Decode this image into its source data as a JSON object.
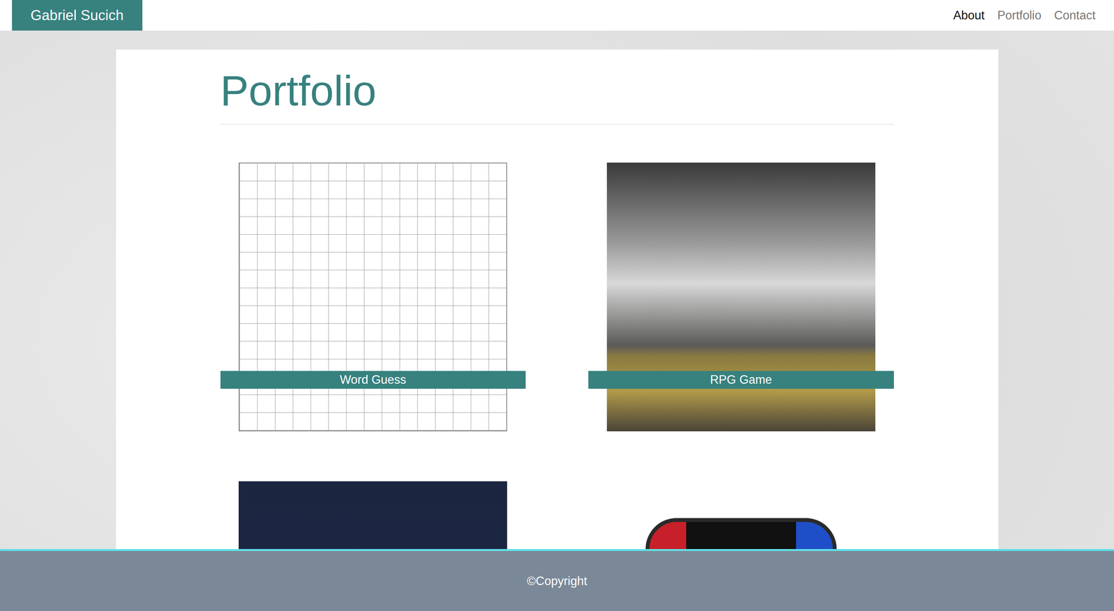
{
  "brand": "Gabriel Sucich",
  "nav": [
    {
      "label": "About",
      "selected": true
    },
    {
      "label": "Portfolio",
      "selected": false
    },
    {
      "label": "Contact",
      "selected": false
    }
  ],
  "heading": "Portfolio",
  "projects": [
    {
      "title": "Word Guess",
      "kind": "crossword"
    },
    {
      "title": "RPG Game",
      "kind": "photo"
    },
    {
      "title": "",
      "kind": "board"
    },
    {
      "title": "",
      "kind": "phone"
    }
  ],
  "footer": "©Copyright"
}
